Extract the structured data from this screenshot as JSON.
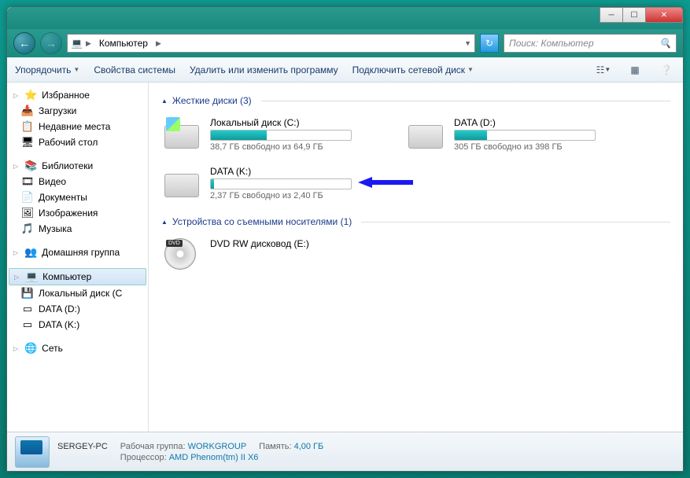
{
  "breadcrumb": {
    "root_icon": "💻",
    "root": "Компьютер"
  },
  "search": {
    "placeholder": "Поиск: Компьютер"
  },
  "toolbar": {
    "organize": "Упорядочить",
    "props": "Свойства системы",
    "uninstall": "Удалить или изменить программу",
    "mapdrive": "Подключить сетевой диск"
  },
  "sidebar": {
    "fav": "Избранное",
    "fav_items": [
      {
        "icon": "📥",
        "label": "Загрузки"
      },
      {
        "icon": "📋",
        "label": "Недавние места"
      },
      {
        "icon": "🖥",
        "label": "Рабочий стол"
      }
    ],
    "lib": "Библиотеки",
    "lib_items": [
      {
        "icon": "🎞",
        "label": "Видео"
      },
      {
        "icon": "📄",
        "label": "Документы"
      },
      {
        "icon": "🖼",
        "label": "Изображения"
      },
      {
        "icon": "🎵",
        "label": "Музыка"
      }
    ],
    "home": "Домашняя группа",
    "computer": "Компьютер",
    "drives": [
      {
        "icon": "💾",
        "label": "Локальный диск (C"
      },
      {
        "icon": "▭",
        "label": "DATA (D:)"
      },
      {
        "icon": "▭",
        "label": "DATA (K:)"
      }
    ],
    "network": "Сеть"
  },
  "sections": {
    "hdd": "Жесткие диски (3)",
    "removable": "Устройства со съемными носителями (1)"
  },
  "drives": [
    {
      "name": "Локальный диск (C:)",
      "free": "38,7 ГБ свободно из 64,9 ГБ",
      "fill": 40,
      "os": true
    },
    {
      "name": "DATA (D:)",
      "free": "305 ГБ свободно из 398 ГБ",
      "fill": 23,
      "os": false
    },
    {
      "name": "DATA (K:)",
      "free": "2,37 ГБ свободно из 2,40 ГБ",
      "fill": 2,
      "os": false
    }
  ],
  "optical": {
    "name": "DVD RW дисковод (E:)",
    "badge": "DVD"
  },
  "status": {
    "name": "SERGEY-PC",
    "wg_label": "Рабочая группа:",
    "wg": "WORKGROUP",
    "mem_label": "Память:",
    "mem": "4,00 ГБ",
    "cpu_label": "Процессор:",
    "cpu": "AMD Phenom(tm) II X6"
  }
}
